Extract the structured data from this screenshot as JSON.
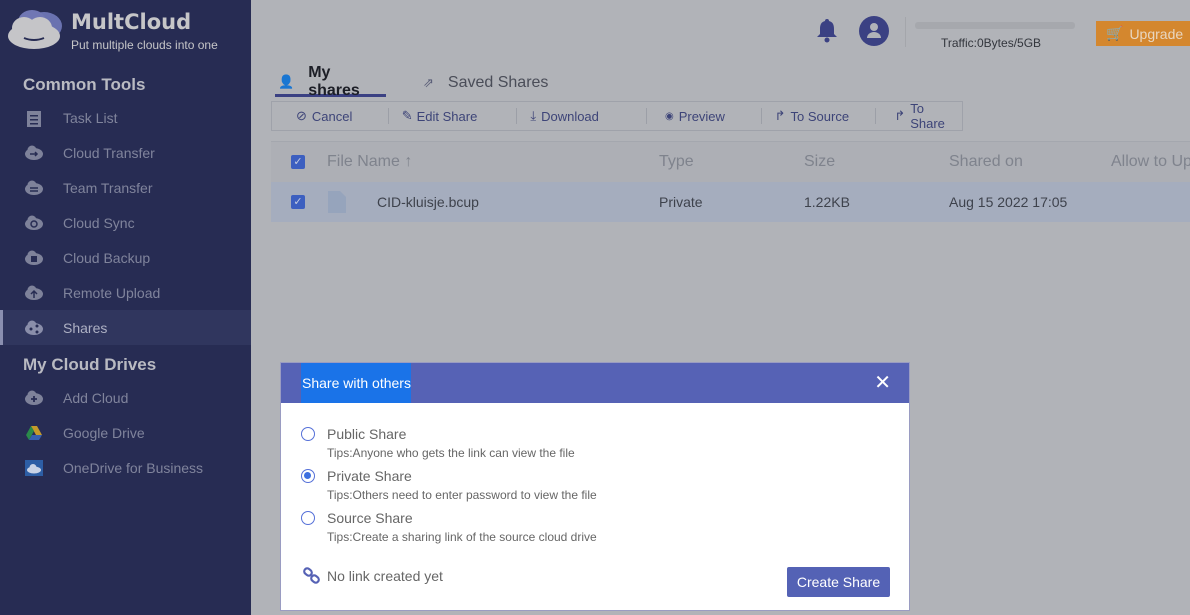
{
  "brand": {
    "name": "MultCloud",
    "tagline": "Put multiple clouds into one"
  },
  "sidebar": {
    "common_tools_title": "Common Tools",
    "common_tools": [
      {
        "label": "Task List"
      },
      {
        "label": "Cloud Transfer"
      },
      {
        "label": "Team Transfer"
      },
      {
        "label": "Cloud Sync"
      },
      {
        "label": "Cloud Backup"
      },
      {
        "label": "Remote Upload"
      },
      {
        "label": "Shares"
      }
    ],
    "drives_title": "My Cloud Drives",
    "drives": [
      {
        "label": "Add Cloud"
      },
      {
        "label": "Google Drive"
      },
      {
        "label": "OneDrive for Business"
      }
    ]
  },
  "header": {
    "traffic": "Traffic:0Bytes/5GB",
    "upgrade": "Upgrade"
  },
  "tabs": [
    {
      "label": "My shares",
      "active": true
    },
    {
      "label": "Saved Shares",
      "active": false
    }
  ],
  "toolbar": {
    "cancel": "Cancel",
    "edit": "Edit Share",
    "download": "Download",
    "preview": "Preview",
    "to_source": "To Source",
    "to_share": "To Share"
  },
  "table": {
    "columns": {
      "name": "File Name",
      "type": "Type",
      "size": "Size",
      "shared_on": "Shared on",
      "allow": "Allow to Up"
    },
    "rows": [
      {
        "name": "CID-kluisje.bcup",
        "type": "Private",
        "size": "1.22KB",
        "shared_on": "Aug 15 2022 17:05"
      }
    ]
  },
  "modal": {
    "title": "Share with others",
    "options": [
      {
        "label": "Public Share",
        "tip": "Tips:Anyone who gets the link can view the file",
        "selected": false
      },
      {
        "label": "Private Share",
        "tip": "Tips:Others need to enter password to view the file",
        "selected": true
      },
      {
        "label": "Source Share",
        "tip": "Tips:Create a sharing link of the source cloud drive",
        "selected": false
      }
    ],
    "link_status": "No link created yet",
    "create_button": "Create Share"
  },
  "colors": {
    "sidebar": "#272c53",
    "accent": "#5662b5",
    "upgrade": "#d4872e"
  }
}
